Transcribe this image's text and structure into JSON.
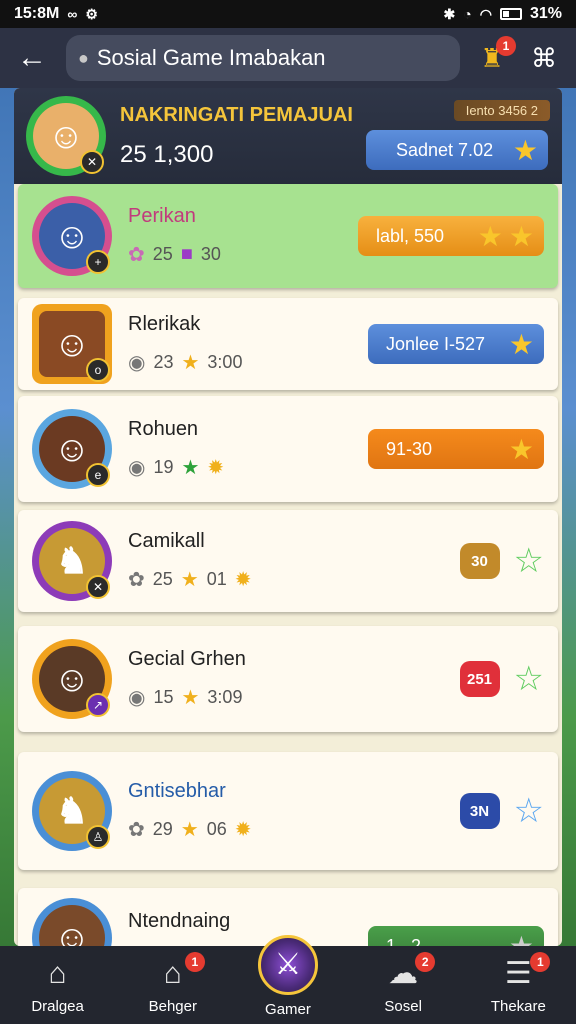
{
  "status": {
    "time": "15:8M",
    "battery": "31%"
  },
  "header": {
    "search_text": "Sosial Game Imabakan",
    "trophy_badge": "1"
  },
  "me": {
    "title": "NAKRINGATI PEMAJUAI",
    "score": "25 1,300",
    "tag": "Iento 3456 2",
    "pill": "Sadnet 7.02"
  },
  "rows": [
    {
      "name": "Perikan",
      "stat1": "25",
      "stat2": "30",
      "pill": "labl, 550"
    },
    {
      "name": "Rlerikak",
      "stat1": "23",
      "stat2": "3:00",
      "pill": "Jonlee I-527"
    },
    {
      "name": "Rohuen",
      "stat1": "19",
      "pill": "91-30"
    },
    {
      "name": "Camikall",
      "stat1": "25",
      "stat2": "01",
      "medal": "30"
    },
    {
      "name": "Gecial Grhen",
      "stat1": "15",
      "stat2": "3:09",
      "medal": "251"
    },
    {
      "name": "Gntisebhar",
      "stat1": "29",
      "stat2": "06",
      "medal": "3N"
    },
    {
      "name": "Ntendnaing",
      "pill": "1 . 2"
    }
  ],
  "tabs": [
    {
      "label": "Dralgea",
      "badge": ""
    },
    {
      "label": "Behger",
      "badge": "1"
    },
    {
      "label": "Gamer",
      "badge": ""
    },
    {
      "label": "Sosel",
      "badge": "2"
    },
    {
      "label": "Thekare",
      "badge": "1"
    }
  ],
  "icons": {
    "back": "arrow-left-icon",
    "search": "search-icon",
    "trophy": "trophy-icon",
    "expand": "expand-icon",
    "star": "star-icon"
  },
  "colors": {
    "highlight_row": "#a7e290",
    "accent_gold": "#f5c53b",
    "tabbar_bg": "#23262f"
  }
}
